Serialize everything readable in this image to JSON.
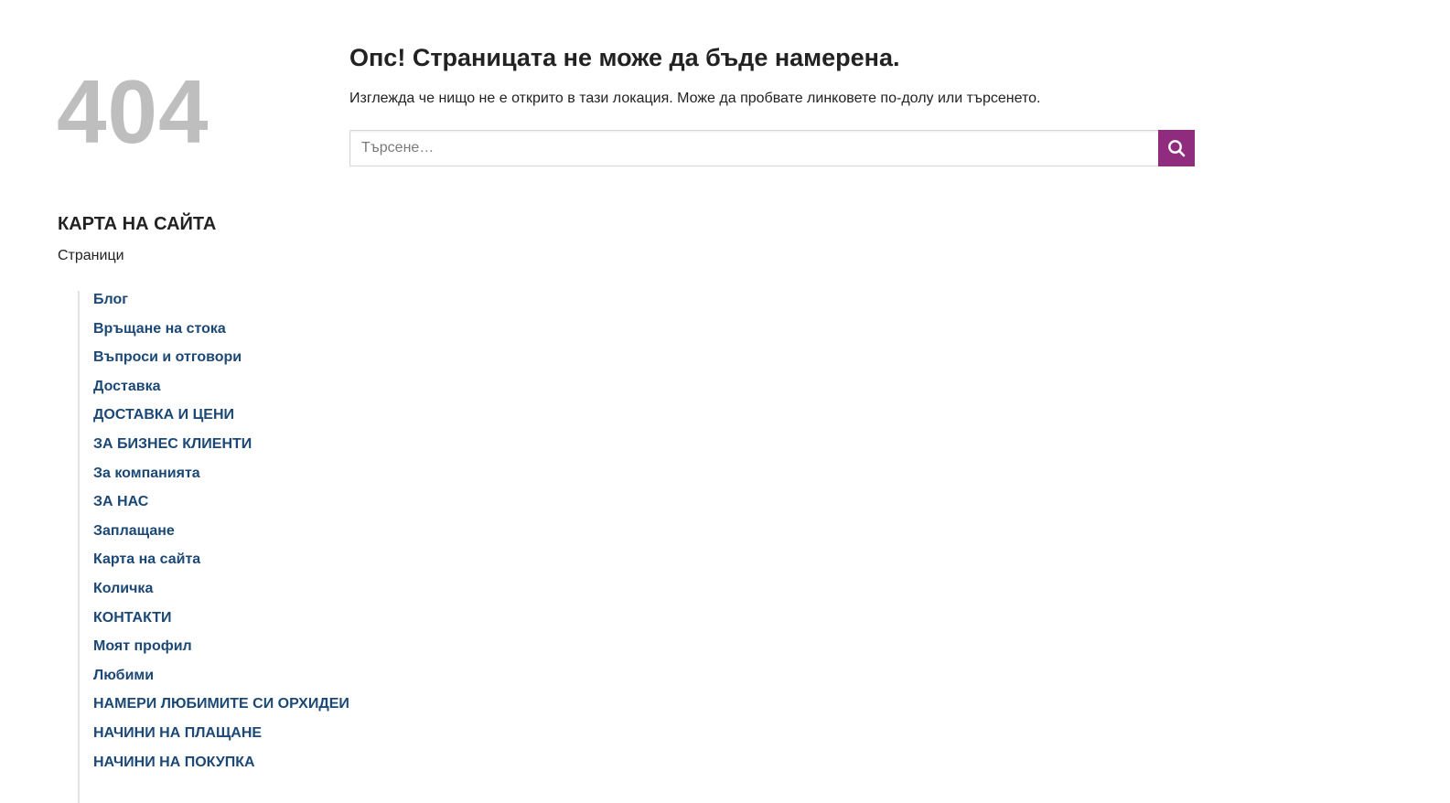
{
  "error": {
    "code": "404",
    "title": "Опс! Страницата не може да бъде намерена.",
    "description": "Изглежда че нищо не е открито в тази локация. Може да пробвате линковете по-долу или търсенето."
  },
  "search": {
    "placeholder": "Търсене…",
    "button_icon": "search-icon",
    "button_color": "#8f2c7d"
  },
  "sitemap": {
    "title": "КАРТА НА САЙТА",
    "pages_label": "Страници",
    "pages": [
      "Блог",
      "Връщане на стока",
      "Въпроси и отговори",
      "Доставка",
      "ДОСТАВКА И ЦЕНИ",
      "ЗА БИЗНЕС КЛИЕНТИ",
      "За компанията",
      "ЗА НАС",
      "Заплащане",
      "Карта на сайта",
      "Количка",
      "КОНТАКТИ",
      "Моят профил",
      "Любими",
      "НАМЕРИ ЛЮБИМИТЕ СИ ОРХИДЕИ",
      "НАЧИНИ НА ПЛАЩАНЕ",
      "НАЧИНИ НА ПОКУПКА"
    ],
    "link_color": "#1b4876"
  }
}
